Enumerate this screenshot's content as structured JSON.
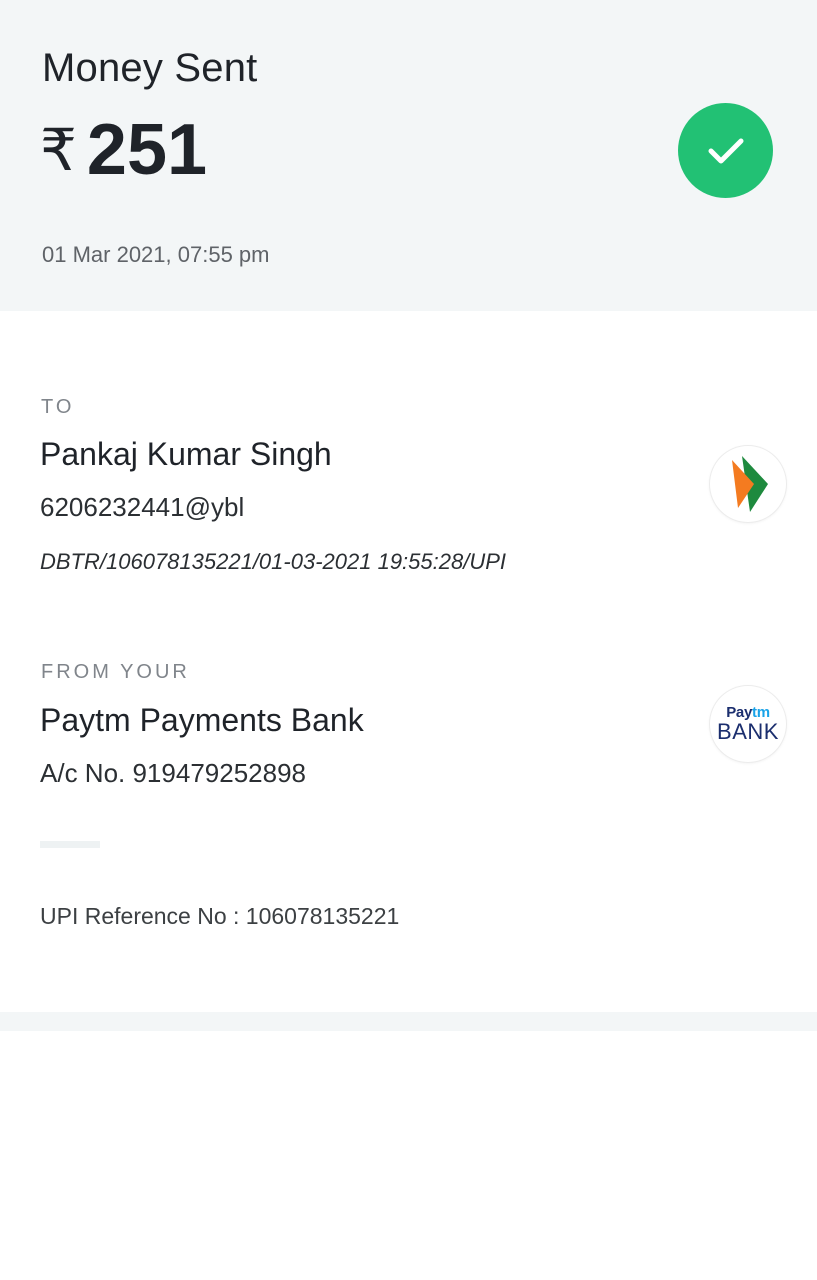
{
  "header": {
    "title": "Money Sent",
    "currency_symbol": "₹",
    "amount": "251",
    "timestamp": "01 Mar 2021, 07:55 pm",
    "status_icon": "check-icon",
    "status_color": "#22c174"
  },
  "to_section": {
    "label": "TO",
    "name": "Pankaj Kumar Singh",
    "upi_id": "6206232441@ybl",
    "transaction_note": "DBTR/106078135221/01-03-2021 19:55:28/UPI",
    "logo_icon": "upi-logo-icon"
  },
  "from_section": {
    "label": "FROM YOUR",
    "bank_name": "Paytm Payments Bank",
    "account": "A/c No. 919479252898",
    "logo_icon": "paytm-bank-logo-icon",
    "logo_text_top_pay": "Pay",
    "logo_text_top_tm": "tm",
    "logo_text_bottom": "BANK"
  },
  "upi_reference": "UPI Reference No : 106078135221"
}
